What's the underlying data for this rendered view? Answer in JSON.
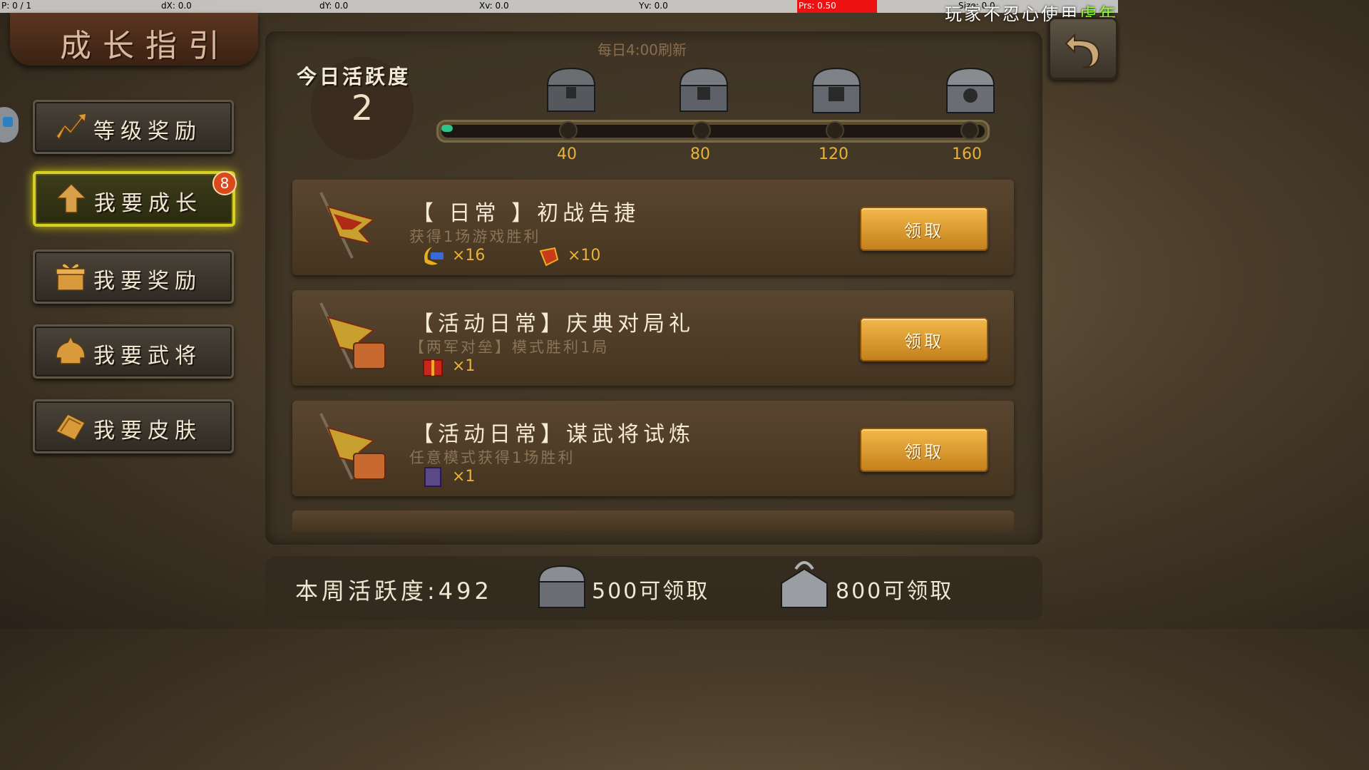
{
  "debug": {
    "pointer": "P: 0 / 1",
    "dx": "dX: 0.0",
    "dy": "dY: 0.0",
    "xv": "Xv: 0.0",
    "yv": "Yv: 0.0",
    "prs": "Prs: 0.50",
    "size": "Size: 0.0"
  },
  "watermark": {
    "prefix": "玩家不忍心使用",
    "highlight": "虎年"
  },
  "title": "成长指引",
  "menu": [
    {
      "label": "等级奖励",
      "icon": "level-up-arrow-icon",
      "active": false
    },
    {
      "label": "我要成长",
      "icon": "growth-arrow-icon",
      "active": true,
      "badge": "8"
    },
    {
      "label": "我要奖励",
      "icon": "gift-icon",
      "active": false
    },
    {
      "label": "我要武将",
      "icon": "helmet-icon",
      "active": false
    },
    {
      "label": "我要皮肤",
      "icon": "skin-card-icon",
      "active": false
    }
  ],
  "activity": {
    "refresh_note": "每日4:00刷新",
    "label": "今日活跃度",
    "value": "2",
    "progress_fraction": 0.0125,
    "milestones": [
      "40",
      "80",
      "120",
      "160"
    ]
  },
  "tasks": [
    {
      "title": "【 日常 】初战告捷",
      "desc": "获得1场游戏胜利",
      "rewards": [
        {
          "icon": "exp-card-icon",
          "count": "×16"
        },
        {
          "icon": "war-flag-token-icon",
          "count": "×10"
        }
      ],
      "button": "领取"
    },
    {
      "title": "【活动日常】庆典对局礼",
      "desc": "【两军对垒】模式胜利1局",
      "rewards": [
        {
          "icon": "red-giftbox-icon",
          "count": "×1"
        }
      ],
      "button": "领取"
    },
    {
      "title": "【活动日常】谋武将试炼",
      "desc": "任意模式获得1场胜利",
      "rewards": [
        {
          "icon": "purple-book-icon",
          "count": "×1"
        }
      ],
      "button": "领取"
    }
  ],
  "weekly": {
    "label": "本周活跃度:492",
    "rewards": [
      {
        "icon": "silver-chest-icon",
        "text": "500可领取"
      },
      {
        "icon": "ornate-chest-icon",
        "text": "800可领取"
      }
    ]
  }
}
